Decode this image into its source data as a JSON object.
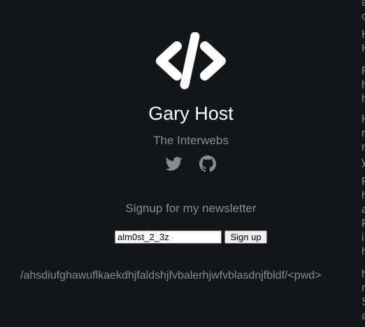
{
  "colors": {
    "background": "#131619",
    "title": "#ffffff",
    "muted_text": "#8a8d90",
    "icon": "#8a8d90",
    "logo": "#ffffff"
  },
  "header": {
    "logo_icon": "code-brackets-icon",
    "title": "Gary Host",
    "subtitle": "The Interwebs"
  },
  "social": {
    "twitter_icon": "twitter-icon",
    "github_icon": "github-icon"
  },
  "newsletter": {
    "heading": "Signup for my newsletter",
    "email_value": "alm0st_2_3z",
    "button_label": "Sign up"
  },
  "path_text": "/ahsdiufghawuflkaekdhjfaldshjfvbalerhjwfvblasdnjfbldf/<pwd>",
  "edge_text": [
    "a",
    "c",
    "H",
    "H",
    "F",
    "h",
    "h",
    "H",
    "n",
    "n",
    "y",
    "F",
    "h",
    "a",
    "F",
    "i",
    "h",
    "h",
    "r",
    "S",
    "a"
  ]
}
